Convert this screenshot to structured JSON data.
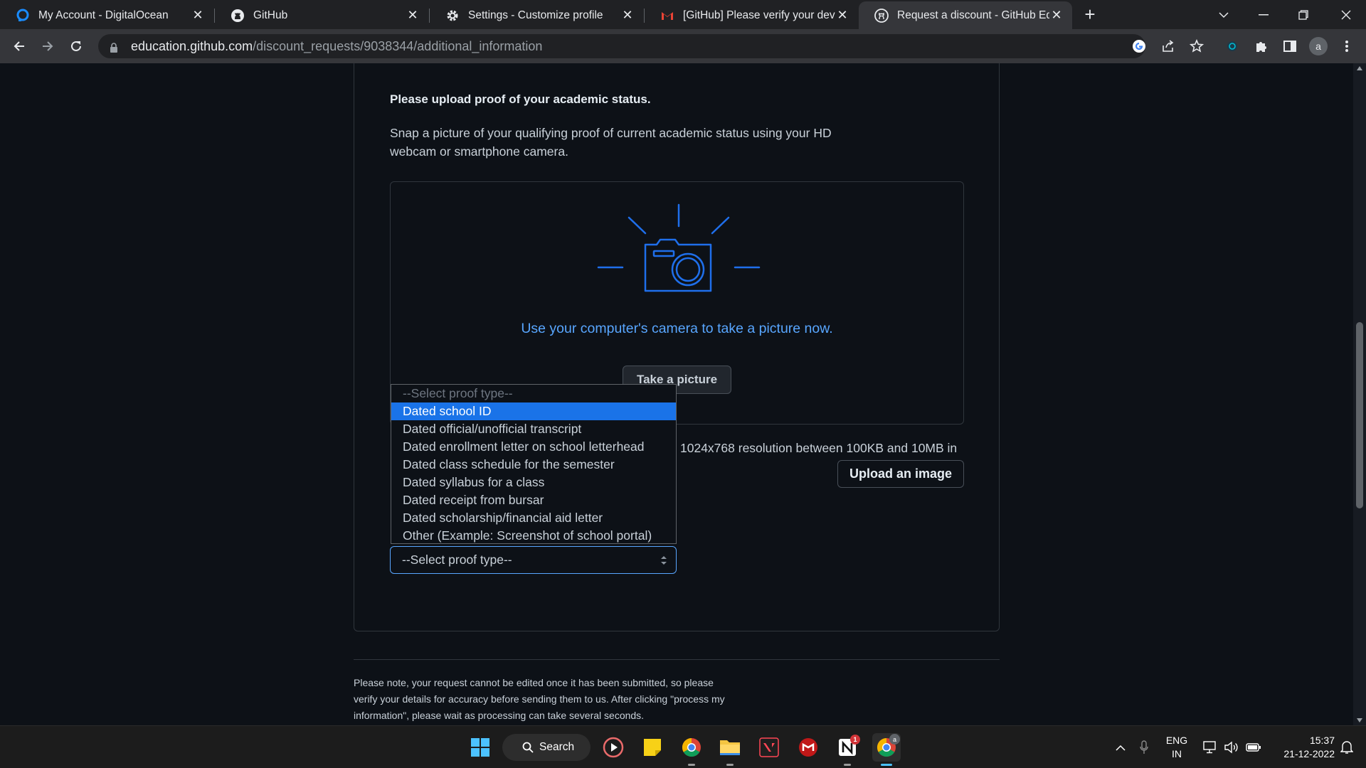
{
  "browser": {
    "tabs": [
      {
        "title": "My Account - DigitalOcean",
        "icon": "digitalocean-icon"
      },
      {
        "title": "GitHub",
        "icon": "github-icon"
      },
      {
        "title": "Settings - Customize profile",
        "icon": "gear-icon"
      },
      {
        "title": "[GitHub] Please verify your device",
        "icon": "gmail-icon"
      },
      {
        "title": "Request a discount - GitHub Education",
        "icon": "github-icon",
        "active": true
      }
    ],
    "new_tab_label": "+",
    "url_host": "education.github.com",
    "url_path": "/discount_requests/9038344/additional_information",
    "profile_initial": "a"
  },
  "page": {
    "heading": "Please upload proof of your academic status.",
    "description": "Snap a picture of your qualifying proof of current academic status using your HD webcam or smartphone camera.",
    "camera_text": "Use your computer's camera to take a picture now.",
    "take_picture_label": "Take a picture",
    "resolution_text": "1024x768 resolution between 100KB and 10MB in",
    "upload_label": "Upload an image",
    "select_value": "--Select proof type--",
    "proof_options": [
      "--Select proof type--",
      "Dated school ID",
      "Dated official/unofficial transcript",
      "Dated enrollment letter on school letterhead",
      "Dated class schedule for the semester",
      "Dated syllabus for a class",
      "Dated receipt from bursar",
      "Dated scholarship/financial aid letter",
      "Other (Example: Screenshot of school portal)"
    ],
    "highlighted_option": "Dated school ID",
    "note": "Please note, your request cannot be edited once it has been submitted, so please verify your details for accuracy before sending them to us. After clicking \"process my information\", please wait as processing can take several seconds.",
    "accent_color": "#58a6ff"
  },
  "taskbar": {
    "search_label": "Search",
    "language_line1": "ENG",
    "language_line2": "IN",
    "time": "15:37",
    "date": "21-12-2022",
    "notion_badge": "1",
    "chrome_profile_badge": "a"
  }
}
